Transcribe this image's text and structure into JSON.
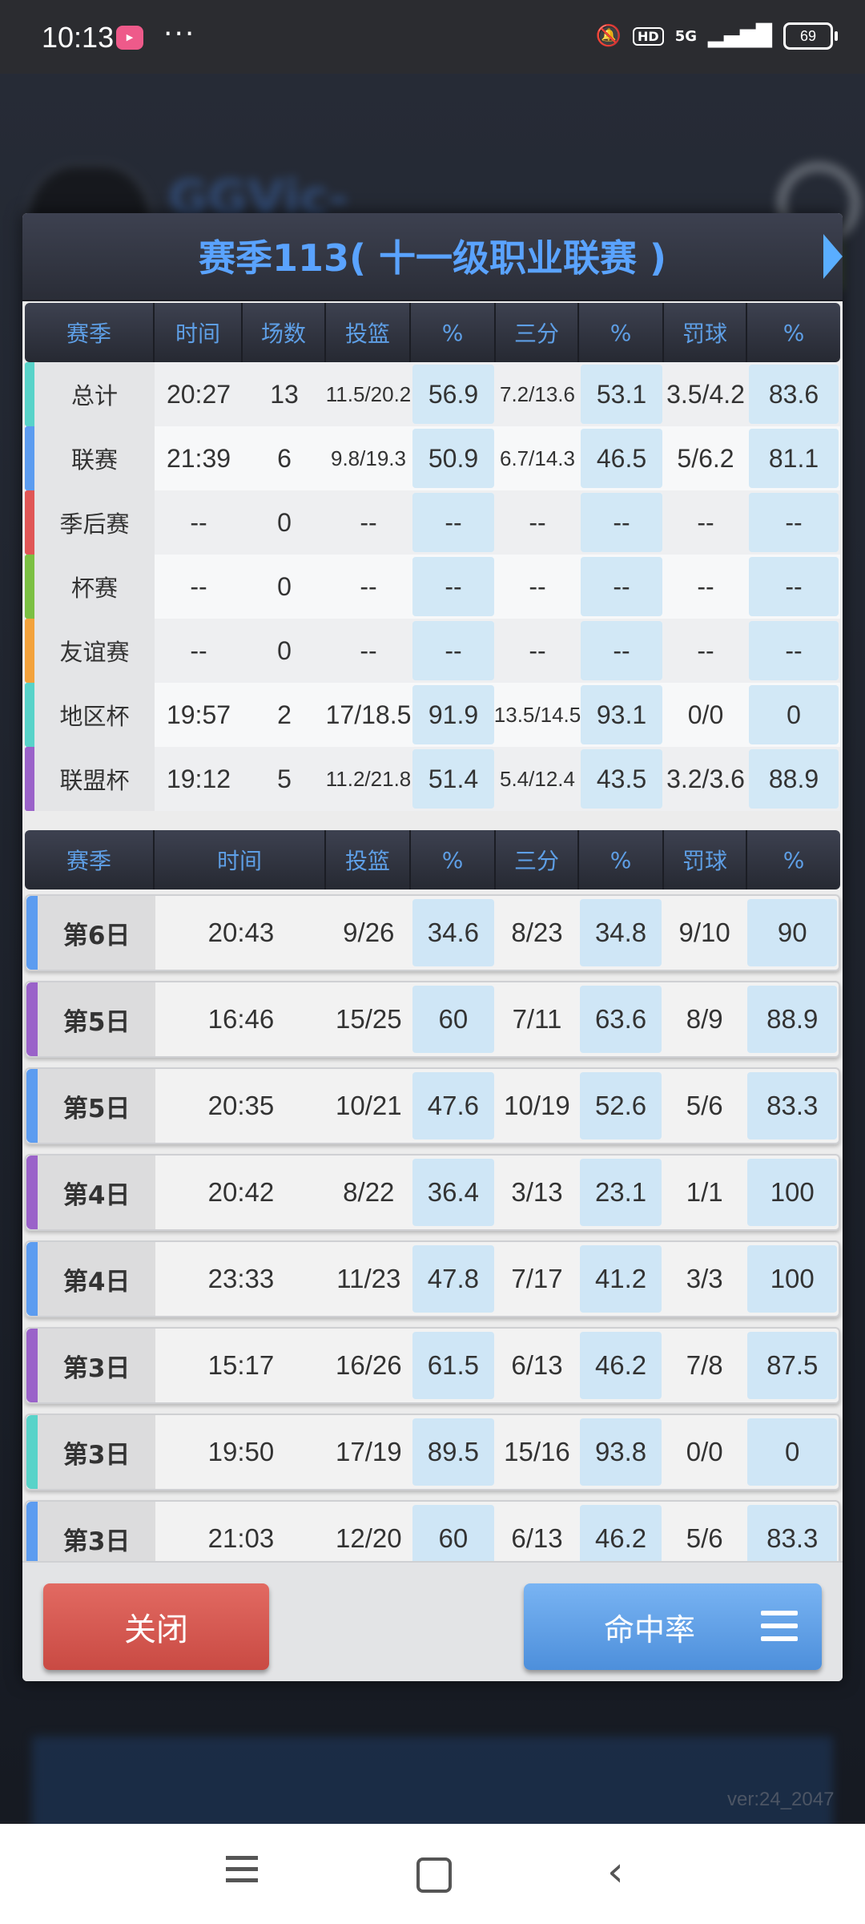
{
  "status_bar": {
    "time": "10:13",
    "app_badge": "bilibili",
    "dots": "···",
    "hd": "HD",
    "net": "5G",
    "battery": "69"
  },
  "background": {
    "title": "GGVic-",
    "version": "ver:24_2047"
  },
  "dialog": {
    "title": "赛季113( 十一级职业联赛 )",
    "summary_headers": [
      "赛季",
      "时间",
      "场数",
      "投篮",
      "%",
      "三分",
      "%",
      "罚球",
      "%"
    ],
    "summary_rows": [
      {
        "label": "总计",
        "time": "20:27",
        "games": "13",
        "fg": "11.5/20.2",
        "fg_pct": "56.9",
        "three": "7.2/13.6",
        "three_pct": "53.1",
        "ft": "3.5/4.2",
        "ft_pct": "83.6",
        "color": "#58d3c9"
      },
      {
        "label": "联赛",
        "time": "21:39",
        "games": "6",
        "fg": "9.8/19.3",
        "fg_pct": "50.9",
        "three": "6.7/14.3",
        "three_pct": "46.5",
        "ft": "5/6.2",
        "ft_pct": "81.1",
        "color": "#5c9cf0"
      },
      {
        "label": "季后赛",
        "time": "--",
        "games": "0",
        "fg": "--",
        "fg_pct": "--",
        "three": "--",
        "three_pct": "--",
        "ft": "--",
        "ft_pct": "--",
        "color": "#e05656"
      },
      {
        "label": "杯赛",
        "time": "--",
        "games": "0",
        "fg": "--",
        "fg_pct": "--",
        "three": "--",
        "three_pct": "--",
        "ft": "--",
        "ft_pct": "--",
        "color": "#7bc043"
      },
      {
        "label": "友谊赛",
        "time": "--",
        "games": "0",
        "fg": "--",
        "fg_pct": "--",
        "three": "--",
        "three_pct": "--",
        "ft": "--",
        "ft_pct": "--",
        "color": "#f3a23c"
      },
      {
        "label": "地区杯",
        "time": "19:57",
        "games": "2",
        "fg": "17/18.5",
        "fg_pct": "91.9",
        "three": "13.5/14.5",
        "three_pct": "93.1",
        "ft": "0/0",
        "ft_pct": "0",
        "color": "#58d3c9"
      },
      {
        "label": "联盟杯",
        "time": "19:12",
        "games": "5",
        "fg": "11.2/21.8",
        "fg_pct": "51.4",
        "three": "5.4/12.4",
        "three_pct": "43.5",
        "ft": "3.2/3.6",
        "ft_pct": "88.9",
        "color": "#9a62c9"
      }
    ],
    "game_headers": [
      "赛季",
      "时间",
      "投篮",
      "%",
      "三分",
      "%",
      "罚球",
      "%"
    ],
    "game_rows": [
      {
        "day": "第6日",
        "time": "20:43",
        "fg": "9/26",
        "fg_pct": "34.6",
        "three": "8/23",
        "three_pct": "34.8",
        "ft": "9/10",
        "ft_pct": "90",
        "color": "#5c9cf0"
      },
      {
        "day": "第5日",
        "time": "16:46",
        "fg": "15/25",
        "fg_pct": "60",
        "three": "7/11",
        "three_pct": "63.6",
        "ft": "8/9",
        "ft_pct": "88.9",
        "color": "#9a62c9"
      },
      {
        "day": "第5日",
        "time": "20:35",
        "fg": "10/21",
        "fg_pct": "47.6",
        "three": "10/19",
        "three_pct": "52.6",
        "ft": "5/6",
        "ft_pct": "83.3",
        "color": "#5c9cf0"
      },
      {
        "day": "第4日",
        "time": "20:42",
        "fg": "8/22",
        "fg_pct": "36.4",
        "three": "3/13",
        "three_pct": "23.1",
        "ft": "1/1",
        "ft_pct": "100",
        "color": "#9a62c9"
      },
      {
        "day": "第4日",
        "time": "23:33",
        "fg": "11/23",
        "fg_pct": "47.8",
        "three": "7/17",
        "three_pct": "41.2",
        "ft": "3/3",
        "ft_pct": "100",
        "color": "#5c9cf0"
      },
      {
        "day": "第3日",
        "time": "15:17",
        "fg": "16/26",
        "fg_pct": "61.5",
        "three": "6/13",
        "three_pct": "46.2",
        "ft": "7/8",
        "ft_pct": "87.5",
        "color": "#9a62c9"
      },
      {
        "day": "第3日",
        "time": "19:50",
        "fg": "17/19",
        "fg_pct": "89.5",
        "three": "15/16",
        "three_pct": "93.8",
        "ft": "0/0",
        "ft_pct": "0",
        "color": "#58d3c9"
      },
      {
        "day": "第3日",
        "time": "21:03",
        "fg": "12/20",
        "fg_pct": "60",
        "three": "6/13",
        "three_pct": "46.2",
        "ft": "5/6",
        "ft_pct": "83.3",
        "color": "#5c9cf0"
      }
    ],
    "close_label": "关闭",
    "rate_label": "命中率"
  }
}
